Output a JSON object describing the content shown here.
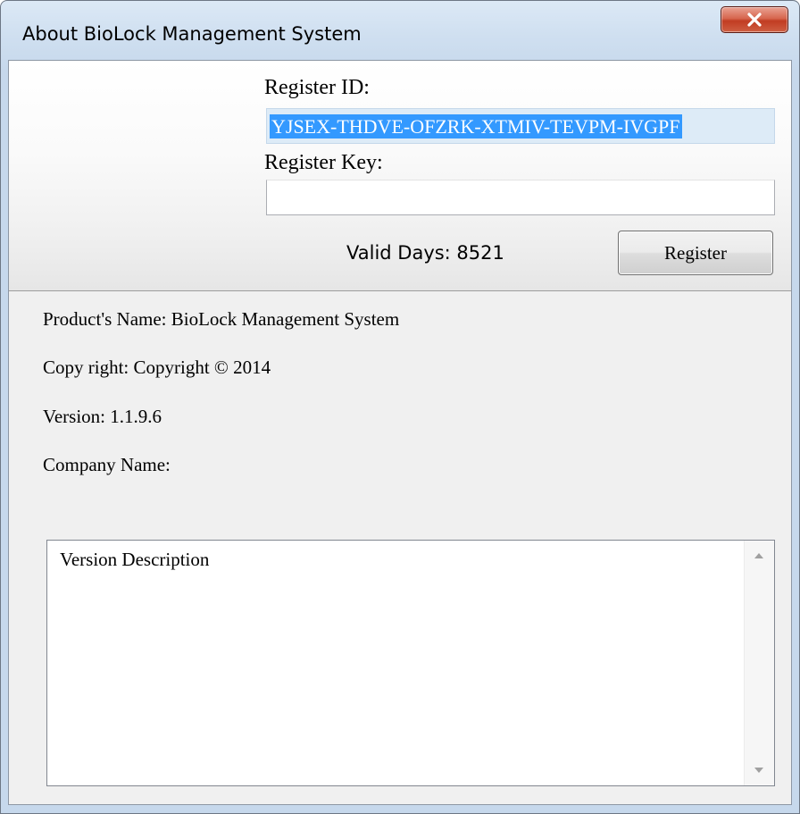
{
  "window": {
    "title": "About BioLock Management System",
    "close_icon": "close-x-icon"
  },
  "registration": {
    "register_id_label": "Register ID:",
    "register_id_value": "YJSEX-THDVE-OFZRK-XTMIV-TEVPM-IVGPF",
    "register_key_label": "Register Key:",
    "register_key_value": "",
    "valid_days_text": "Valid Days: 8521",
    "register_button_label": "Register"
  },
  "info": {
    "product_name": "Product's Name: BioLock Management System",
    "copyright": "Copy right: Copyright © 2014",
    "version": "Version: 1.1.9.6",
    "company_name": "Company Name:"
  },
  "description": {
    "text": "Version Description",
    "scroll_up_icon": "scroll-up-arrow-icon",
    "scroll_down_icon": "scroll-down-arrow-icon"
  },
  "colors": {
    "selection": "#3399ff",
    "close_button": "#c13c22",
    "title_bar": "#cfdff0"
  }
}
